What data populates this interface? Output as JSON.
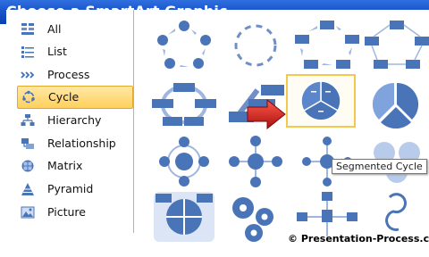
{
  "window": {
    "title": "Choose a SmartArt Graphic"
  },
  "categories": [
    {
      "label": "All",
      "icon": "all-icon",
      "selected": false
    },
    {
      "label": "List",
      "icon": "list-icon",
      "selected": false
    },
    {
      "label": "Process",
      "icon": "process-icon",
      "selected": false
    },
    {
      "label": "Cycle",
      "icon": "cycle-icon",
      "selected": true
    },
    {
      "label": "Hierarchy",
      "icon": "hierarchy-icon",
      "selected": false
    },
    {
      "label": "Relationship",
      "icon": "relationship-icon",
      "selected": false
    },
    {
      "label": "Matrix",
      "icon": "matrix-icon",
      "selected": false
    },
    {
      "label": "Pyramid",
      "icon": "pyramid-icon",
      "selected": false
    },
    {
      "label": "Picture",
      "icon": "picture-icon",
      "selected": false
    }
  ],
  "gallery": {
    "selected_tooltip": "Segmented Cycle"
  },
  "watermark": "© Presentation-Process.com",
  "colors": {
    "title_bar": "#1a55c9",
    "accent": "#4a74b8",
    "selection": "#ffcf5c",
    "arrow": "#d11a1a"
  }
}
